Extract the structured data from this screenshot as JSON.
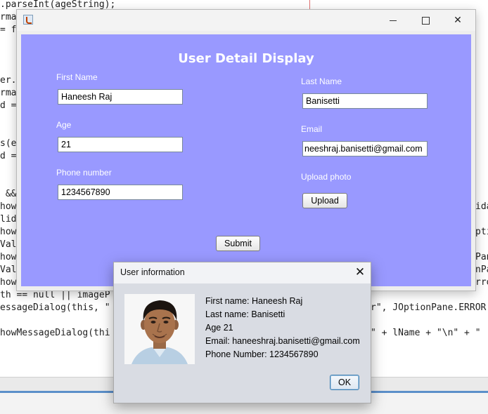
{
  "editor": {
    "lines": [
      ".parseInt(ageString);",
      "rma",
      "= f",
      "er.",
      "rma",
      "d =",
      "s(e",
      "d =",
      " &&",
      "how",
      "lid",
      "how",
      "Val",
      "how",
      "Val",
      "how",
      "th == null || imageP",
      "essageDialog(this, \"",
      "howMessageDialog(thi"
    ],
    "right_fragments": [
      "ida",
      "pti",
      "Pan",
      "nPa",
      "rro",
      "r\", JOptionPane.ERROR",
      "\" + lName + \"\\n\" + \""
    ]
  },
  "frame": {
    "icon": "java-cup-icon",
    "minimize_icon": "minimize-icon",
    "maximize_icon": "maximize-icon",
    "close_icon": "close-icon",
    "close_glyph": "✕",
    "background_color": "#9999ff"
  },
  "form": {
    "title": "User Detail Display",
    "first_name_label": "First Name",
    "first_name_value": "Haneesh Raj",
    "last_name_label": "Last Name",
    "last_name_value": "Banisetti",
    "age_label": "Age",
    "age_value": "21",
    "email_label": "Email",
    "email_value": "neeshraj.banisetti@gmail.com",
    "phone_label": "Phone number",
    "phone_value": "1234567890",
    "upload_label": "Upload photo",
    "upload_button": "Upload",
    "submit_button": "Submit"
  },
  "dialog": {
    "title": "User information",
    "close_glyph": "✕",
    "lines": [
      "First name: Haneesh Raj",
      "Last name: Banisetti",
      "Age 21",
      "Email: haneeshraj.banisetti@gmail.com",
      "Phone Number: 1234567890"
    ],
    "ok_button": "OK"
  }
}
